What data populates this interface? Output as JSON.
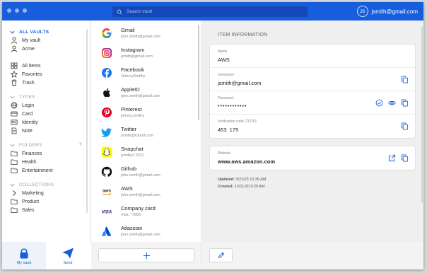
{
  "titlebar": {
    "search_placeholder": "Search vault",
    "avatar_initials": "JS",
    "account_email": "jsmith@gmail.com",
    "brand_color": "#175ddc"
  },
  "sidebar": {
    "all_vaults": "ALL VAULTS",
    "vaults": [
      {
        "label": "My vault",
        "icon": "person-icon"
      },
      {
        "label": "Acme",
        "icon": "person-icon"
      }
    ],
    "filters": [
      {
        "label": "All items",
        "icon": "grid-icon"
      },
      {
        "label": "Favorites",
        "icon": "star-icon"
      },
      {
        "label": "Trash",
        "icon": "trash-icon"
      }
    ],
    "types_heading": "TYPES",
    "types": [
      {
        "label": "Login",
        "icon": "globe-icon"
      },
      {
        "label": "Card",
        "icon": "card-icon"
      },
      {
        "label": "Identity",
        "icon": "id-icon"
      },
      {
        "label": "Note",
        "icon": "note-icon"
      }
    ],
    "folders_heading": "FOLDERS",
    "folders": [
      {
        "label": "Finances",
        "icon": "folder-icon"
      },
      {
        "label": "Health",
        "icon": "folder-icon"
      },
      {
        "label": "Entertainment",
        "icon": "folder-icon"
      }
    ],
    "collections_heading": "COLLECTIONS",
    "collections": [
      {
        "label": "Marketing",
        "icon": "chevron-right-icon"
      },
      {
        "label": "Product",
        "icon": "folder-icon"
      },
      {
        "label": "Sales",
        "icon": "folder-icon"
      }
    ]
  },
  "bottomnav": {
    "my_vault": "My vault",
    "send": "Send"
  },
  "list": {
    "items": [
      {
        "name": "Gmail",
        "sub": "john.smith@gmail.com",
        "icon": "google-logo-icon"
      },
      {
        "name": "Instagram",
        "sub": "jsmith@gmail.com",
        "icon": "instagram-logo-icon"
      },
      {
        "name": "Facebook",
        "sub": "JohnnySmithy",
        "icon": "facebook-logo-icon"
      },
      {
        "name": "AppleID",
        "sub": "john.smith@gmail.com",
        "icon": "apple-logo-icon"
      },
      {
        "name": "Pinterest",
        "sub": "johnny.smithy",
        "icon": "pinterest-logo-icon"
      },
      {
        "name": "Twitter",
        "sub": "jsmith@icloud.com",
        "icon": "twitter-logo-icon"
      },
      {
        "name": "Snapchat",
        "sub": "jsmithy17822",
        "icon": "snapchat-logo-icon"
      },
      {
        "name": "Github",
        "sub": "john.smith@gmail.com",
        "icon": "github-logo-icon"
      },
      {
        "name": "AWS",
        "sub": "john.smith@gmail.com",
        "icon": "aws-logo-icon"
      },
      {
        "name": "Company card",
        "sub": "Visa, *7899",
        "icon": "visa-logo-icon"
      },
      {
        "name": "Atlassian",
        "sub": "john.smith@gmail.com",
        "icon": "atlassian-logo-icon"
      }
    ]
  },
  "detail": {
    "heading": "ITEM INFORMATION",
    "name_label": "Name",
    "name_value": "AWS",
    "username_label": "Username",
    "username_value": "jsmith@gmail.com",
    "password_label": "Password",
    "password_value": "••••••••••••",
    "totp_label": "Verification code (TOTP)",
    "totp_value": "453  179",
    "website_label": "Website",
    "website_value": "www.aws.amazon.com",
    "updated_label": "Updated:",
    "updated_value": "3/21/23 10:36 AM",
    "created_label": "Created:",
    "created_value": "12/11/20 9:29 AM"
  }
}
